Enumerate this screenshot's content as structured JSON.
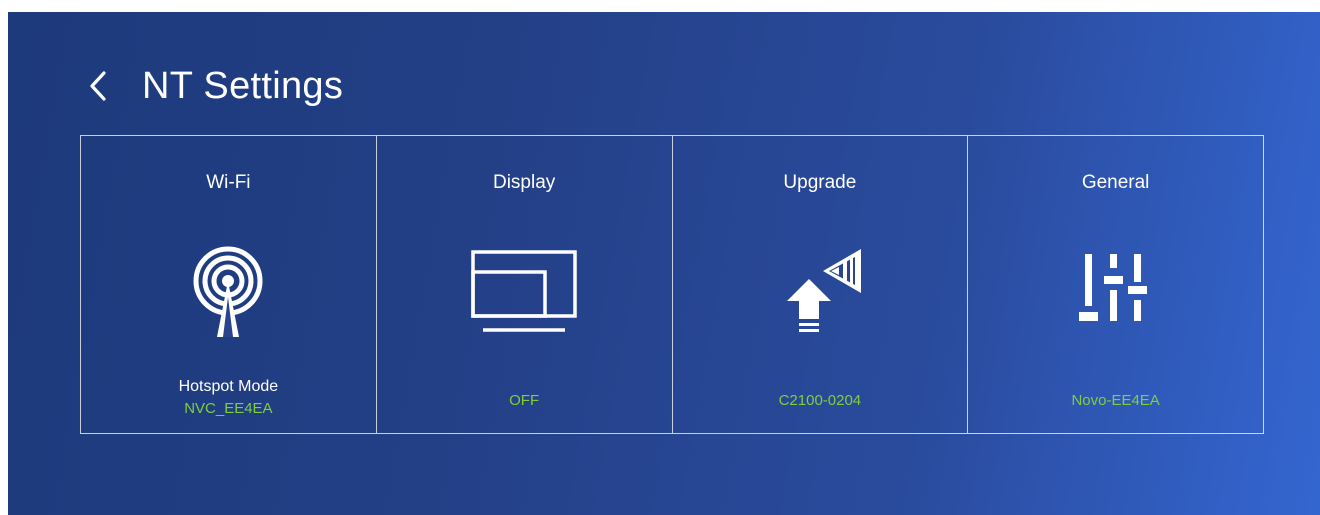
{
  "header": {
    "back_icon": "chevron-left-icon",
    "title": "NT Settings"
  },
  "colors": {
    "status_text": "#7fcf3c",
    "background_start": "#1d3a7c",
    "background_end": "#3466d1"
  },
  "panels": [
    {
      "title": "Wi-Fi",
      "icon": "wifi-antenna-icon",
      "subtitle": "Hotspot Mode",
      "status": "NVC_EE4EA"
    },
    {
      "title": "Display",
      "icon": "display-icon",
      "status": "OFF"
    },
    {
      "title": "Upgrade",
      "icon": "upgrade-icon",
      "status": "C2100-0204"
    },
    {
      "title": "General",
      "icon": "sliders-icon",
      "status": "Novo-EE4EA"
    }
  ]
}
